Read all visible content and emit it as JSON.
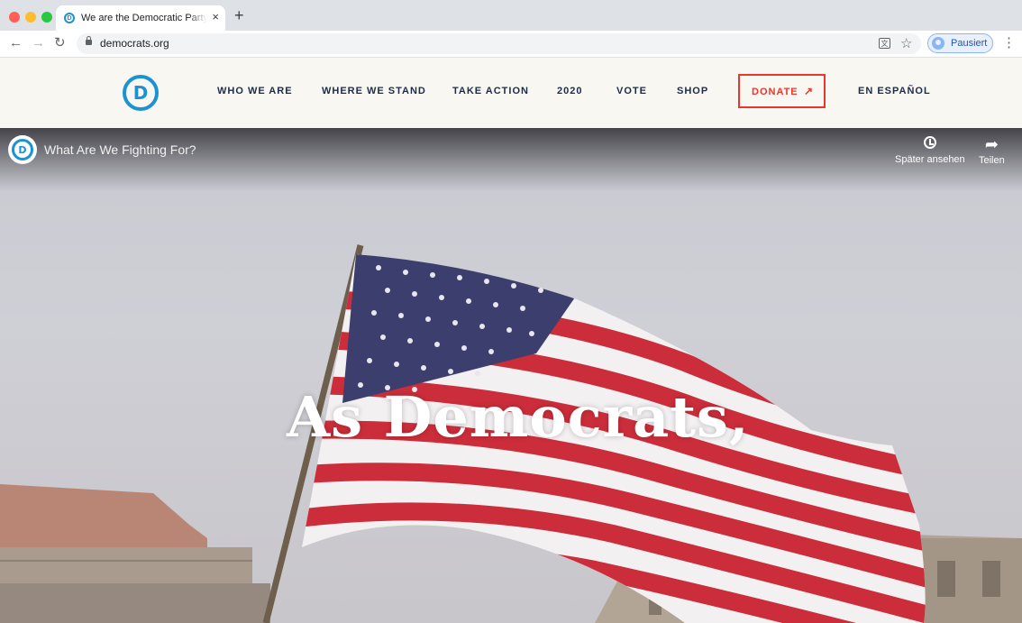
{
  "browser": {
    "tab_title": "We are the Democratic Party - Democrats",
    "new_tab_symbol": "+",
    "close_symbol": "×",
    "url": "democrats.org",
    "profile_label": "Pausiert"
  },
  "site": {
    "logo_letter": "D",
    "nav": [
      {
        "label": "WHO WE ARE"
      },
      {
        "label": "WHERE WE STAND"
      },
      {
        "label": "TAKE ACTION"
      },
      {
        "label": "2020"
      },
      {
        "label": "VOTE"
      },
      {
        "label": "SHOP"
      }
    ],
    "donate_label": "DONATE",
    "donate_arrow": "↗",
    "espanol_label": "EN ESPAÑOL",
    "colors": {
      "brand_blue": "#1b93d2",
      "donate_red": "#e9372d",
      "nav_text": "#1d2b4c",
      "header_bg": "#f8f7f1"
    }
  },
  "video": {
    "channel_letter": "D",
    "title": "What Are We Fighting For?",
    "watch_later_label": "Später ansehen",
    "share_label": "Teilen",
    "caption": "As Democrats,"
  }
}
